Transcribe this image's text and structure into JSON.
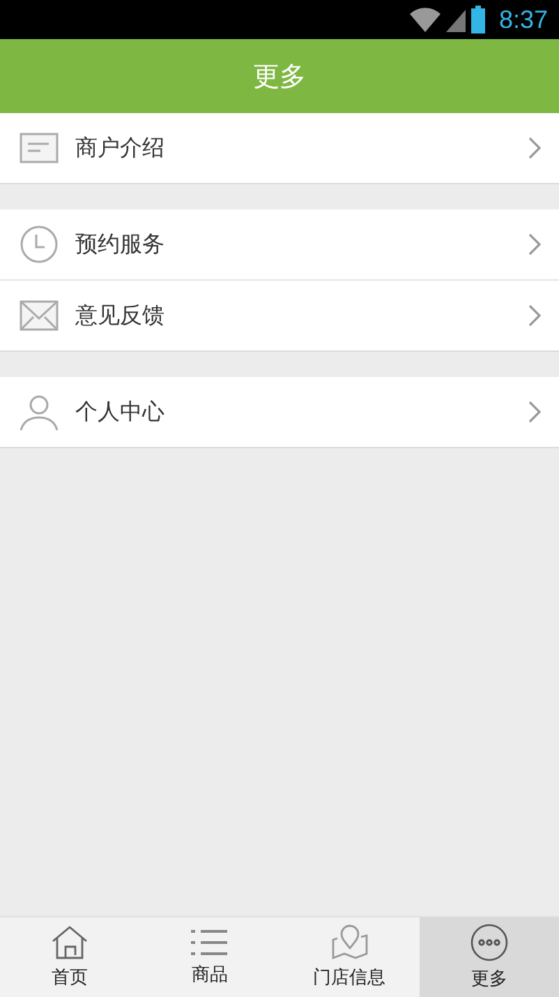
{
  "status_bar": {
    "time": "8:37"
  },
  "header": {
    "title": "更多"
  },
  "sections": [
    {
      "items": [
        {
          "label": "商户介绍"
        }
      ]
    },
    {
      "items": [
        {
          "label": "预约服务"
        },
        {
          "label": "意见反馈"
        }
      ]
    },
    {
      "items": [
        {
          "label": "个人中心"
        }
      ]
    }
  ],
  "tab_bar": [
    {
      "label": "首页",
      "selected": false
    },
    {
      "label": "商品",
      "selected": false
    },
    {
      "label": "门店信息",
      "selected": false
    },
    {
      "label": "更多",
      "selected": true
    }
  ]
}
